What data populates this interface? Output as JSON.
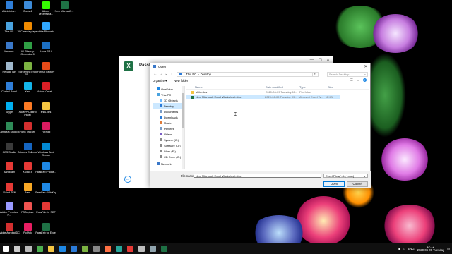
{
  "desktop": {
    "icons": [
      {
        "label": "Administra...",
        "color": "#2f7ed8"
      },
      {
        "label": "iTools 4",
        "color": "#3d8bd9"
      },
      {
        "label": "Adobe Dreamwea...",
        "color": "#35fa00"
      },
      {
        "label": "New Microsoft ...",
        "color": "#1e7145"
      },
      {
        "label": "This PC",
        "color": "#4aa3df"
      },
      {
        "label": "VLC media player",
        "color": "#f08a00"
      },
      {
        "label": "Adobe Photosh...",
        "color": "#31a8ff"
      },
      {
        "label": "Network",
        "color": "#3a78c9"
      },
      {
        "label": "A1 Sitemap Generator 8",
        "color": "#2f9e44"
      },
      {
        "label": "Azure RP 8",
        "color": "#1c6fc1"
      },
      {
        "label": "Recycle Bin",
        "color": "#9fb8cc"
      },
      {
        "label": "Screaming Frog SE...",
        "color": "#7cb342"
      },
      {
        "label": "Format Factory",
        "color": "#e64a19"
      },
      {
        "label": "Control Panel",
        "color": "#2f7ed8"
      },
      {
        "label": "Xero",
        "color": "#13b5ea"
      },
      {
        "label": "Adobe Creati...",
        "color": "#da1f26"
      },
      {
        "label": "Skype",
        "color": "#00aff0"
      },
      {
        "label": "XAMPP Control Panel",
        "color": "#fb7a24"
      },
      {
        "label": "shitu-des",
        "color": "#f4c542"
      },
      {
        "label": "Camtasia Studio 8",
        "color": "#2e8b57"
      },
      {
        "label": "Rank Tracker",
        "color": "#d32f2f"
      },
      {
        "label": "Foxmail",
        "color": "#d81b60"
      },
      {
        "label": "OBS Studio",
        "color": "#3a3a3a"
      },
      {
        "label": "Octopus Collector",
        "color": "#1565c0"
      },
      {
        "label": "Windows Boot Genius",
        "color": "#0288d1"
      },
      {
        "label": "Bandicam",
        "color": "#e53935"
      },
      {
        "label": "XMind 8",
        "color": "#e53935"
      },
      {
        "label": "PassFab iPhone...",
        "color": "#1e88e5"
      },
      {
        "label": "XMind ZEN",
        "color": "#e53935"
      },
      {
        "label": "Paint",
        "color": "#f9a825"
      },
      {
        "label": "PassFab 4WinKey",
        "color": "#1e88e5"
      },
      {
        "label": "Adobe Premiere P...",
        "color": "#9999ff"
      },
      {
        "label": "FSCapture",
        "color": "#ef5350"
      },
      {
        "label": "PassFab for PDF",
        "color": "#e53935"
      },
      {
        "label": "Adobe Acrobat DC",
        "color": "#d32f2f"
      },
      {
        "label": "PicPick",
        "color": "#e91e63"
      },
      {
        "label": "PassFab for Excel",
        "color": "#1e7145"
      }
    ]
  },
  "app_window": {
    "title": "PassFab"
  },
  "dialog": {
    "title": "Open",
    "close_label": "✕",
    "address": {
      "back": "←",
      "forward": "→",
      "recent": "⌄",
      "up": "↑",
      "crumb1": "This PC",
      "sep": "›",
      "crumb2": "Desktop",
      "refresh": "↻",
      "search_placeholder": "Search Desktop"
    },
    "toolbar": {
      "organize": "Organize ▾",
      "new_folder": "New folder"
    },
    "nav_items": [
      {
        "label": "OneDrive",
        "color": "#1e88e5",
        "top": true,
        "selected": false
      },
      {
        "label": "This PC",
        "color": "#4aa3df",
        "top": true,
        "selected": false
      },
      {
        "label": "3D Objects",
        "color": "#6ab7ff",
        "top": false,
        "selected": false
      },
      {
        "label": "Desktop",
        "color": "#2b7bd8",
        "top": false,
        "selected": true
      },
      {
        "label": "Documents",
        "color": "#7a9cc6",
        "top": false,
        "selected": false
      },
      {
        "label": "Downloads",
        "color": "#2b7bd8",
        "top": false,
        "selected": false
      },
      {
        "label": "Music",
        "color": "#e07b39",
        "top": false,
        "selected": false
      },
      {
        "label": "Pictures",
        "color": "#7a9cc6",
        "top": false,
        "selected": false
      },
      {
        "label": "Videos",
        "color": "#7a5cc6",
        "top": false,
        "selected": false
      },
      {
        "label": "System (C:)",
        "color": "#8a8a8a",
        "top": false,
        "selected": false
      },
      {
        "label": "Software (D:)",
        "color": "#8a8a8a",
        "top": false,
        "selected": false
      },
      {
        "label": "Work (E:)",
        "color": "#8a8a8a",
        "top": false,
        "selected": false
      },
      {
        "label": "CD Drive (G:)",
        "color": "#8a8a8a",
        "top": false,
        "selected": false
      },
      {
        "label": "Network",
        "color": "#3a78c9",
        "top": true,
        "selected": false
      }
    ],
    "columns": {
      "name": "Name",
      "date": "Date modified",
      "type": "Type",
      "size": "Size"
    },
    "files": [
      {
        "name": "shitu-des",
        "date": "2020-06-09 Tuesday 11...",
        "type": "File folder",
        "size": "",
        "color": "#f4c542",
        "selected": false
      },
      {
        "name": "New Microsoft Excel Worksheet.xlsx",
        "date": "2020-06-09 Tuesday 09...",
        "type": "Microsoft Excel W...",
        "size": "6 KB",
        "color": "#1e7145",
        "selected": true
      }
    ],
    "file_name_label": "File name:",
    "file_name_value": "New Microsoft Excel Worksheet.xlsx",
    "file_type_value": "Excel Files(*.xls;*.xlsx)",
    "open_label": "Open",
    "cancel_label": "Cancel"
  },
  "taskbar": {
    "apps": [
      {
        "name": "start",
        "color": "#ffffff"
      },
      {
        "name": "search",
        "color": "#cccccc"
      },
      {
        "name": "task-view",
        "color": "#bbbbbb"
      },
      {
        "name": "chrome",
        "color": "#4caf50"
      },
      {
        "name": "explorer",
        "color": "#f4c542"
      },
      {
        "name": "edge",
        "color": "#1e88e5"
      },
      {
        "name": "store",
        "color": "#2b7bd8"
      },
      {
        "name": "app1",
        "color": "#7cb342"
      },
      {
        "name": "app2",
        "color": "#888888"
      },
      {
        "name": "firefox",
        "color": "#ff7043"
      },
      {
        "name": "app3",
        "color": "#26a69a"
      },
      {
        "name": "app4",
        "color": "#e53935"
      },
      {
        "name": "app5",
        "color": "#bdbdbd"
      },
      {
        "name": "app6",
        "color": "#90a4ae"
      },
      {
        "name": "excel",
        "color": "#1e7145"
      }
    ],
    "lang": "ENG",
    "time": "17:12",
    "date": "2020-06-09 Tuesday"
  }
}
